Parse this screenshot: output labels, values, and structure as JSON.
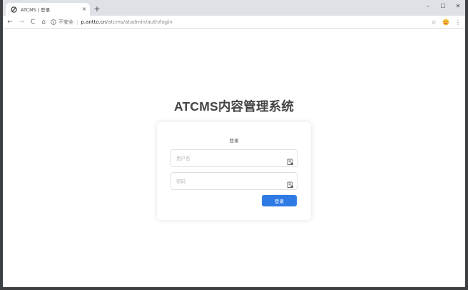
{
  "browser": {
    "tab_title": "ATCMS | 登录",
    "tab_close": "×",
    "new_tab": "+",
    "window_controls": {
      "minimize": "–",
      "maximize": "☐",
      "close": "✕"
    },
    "nav": {
      "back": "←",
      "forward": "→",
      "reload": "C",
      "home": "⌂"
    },
    "address": {
      "security_label": "不安全",
      "separator": "|",
      "host": "p.antto.cn",
      "path": "/atcms/atadmin/auth/login"
    },
    "toolbar_right": {
      "bookmark": "☆",
      "menu": "⋮"
    }
  },
  "page": {
    "title": "ATCMS内容管理系统",
    "login_card": {
      "heading": "登录",
      "username_placeholder": "用户名",
      "password_placeholder": "密码",
      "submit_label": "登录"
    }
  },
  "colors": {
    "accent": "#2f7ae5",
    "title": "#444444",
    "chrome_bar": "#dee1e6"
  }
}
